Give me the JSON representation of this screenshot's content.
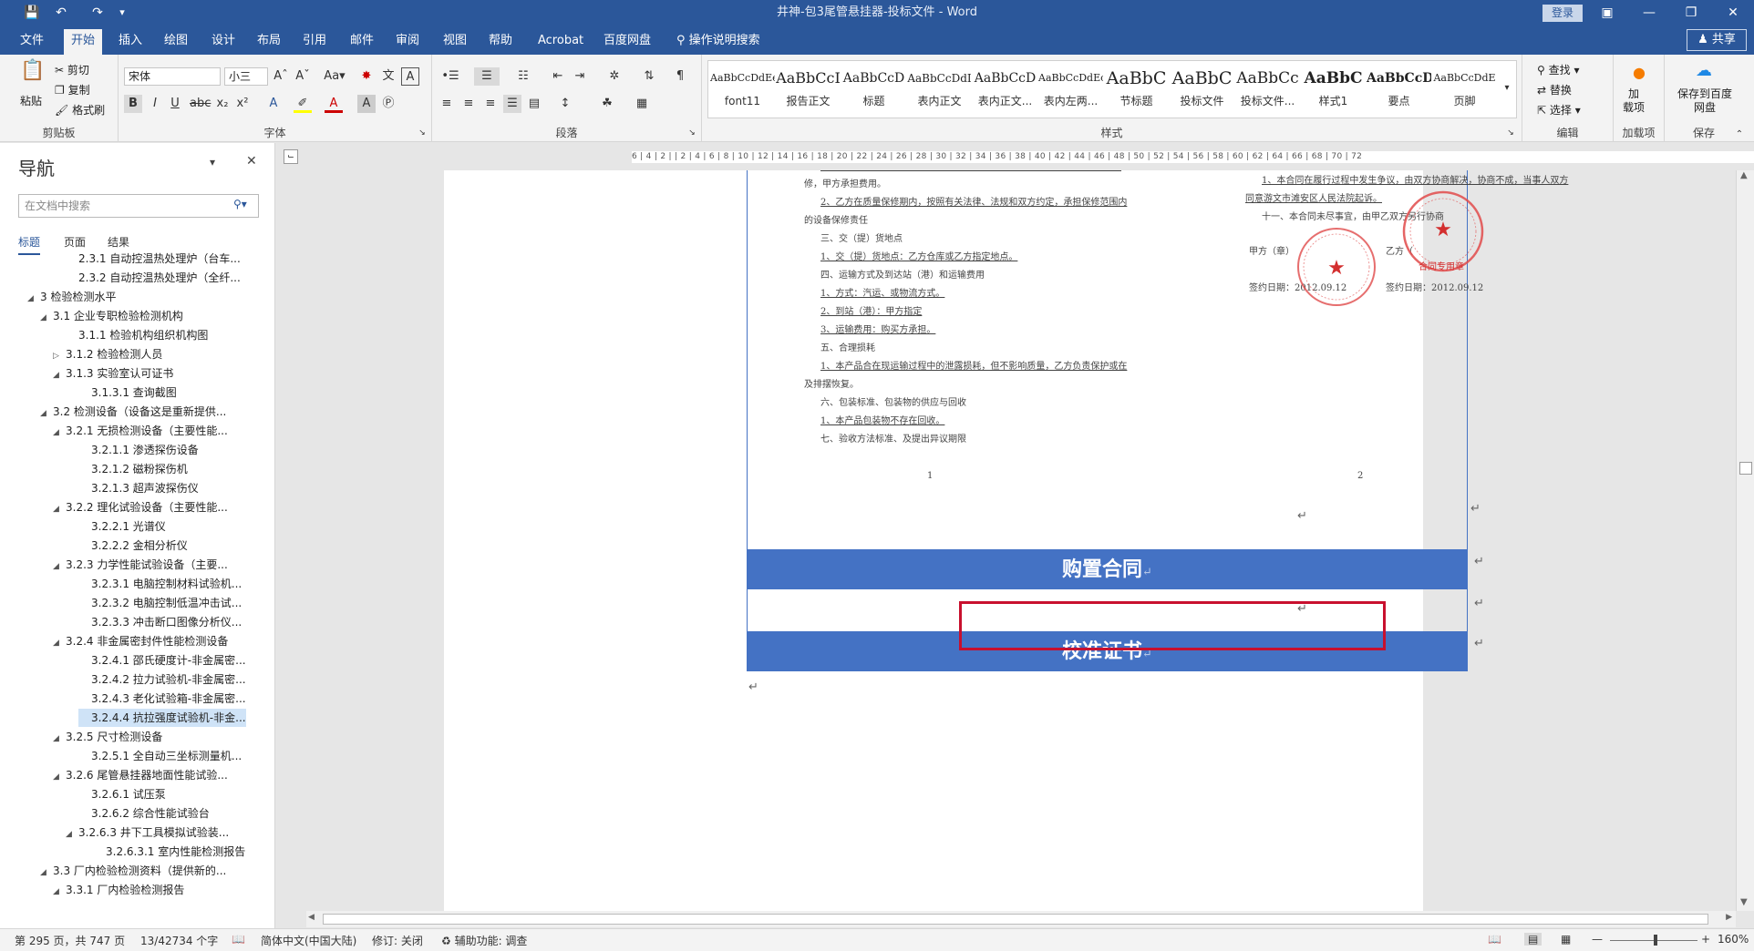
{
  "window": {
    "title": "井神-包3尾管悬挂器-投标文件 - Word",
    "login": "登录",
    "share": "共享"
  },
  "tabs": [
    "文件",
    "开始",
    "插入",
    "绘图",
    "设计",
    "布局",
    "引用",
    "邮件",
    "审阅",
    "视图",
    "帮助",
    "Acrobat",
    "百度网盘",
    "操作说明搜索"
  ],
  "ribbon": {
    "clipboard": {
      "paste": "粘贴",
      "cut": "剪切",
      "copy": "复制",
      "format_painter": "格式刷",
      "label": "剪贴板"
    },
    "font": {
      "name": "宋体",
      "size": "小三",
      "label": "字体"
    },
    "paragraph": {
      "label": "段落"
    },
    "styles": {
      "label": "样式",
      "items": [
        {
          "preview": "AaBbCcDdEe",
          "name": "font11"
        },
        {
          "preview": "AaBbCcI",
          "name": "报告正文"
        },
        {
          "preview": "AaBbCcD",
          "name": "标题"
        },
        {
          "preview": "AaBbCcDdI",
          "name": "表内正文"
        },
        {
          "preview": "AaBbCcD",
          "name": "表内正文..."
        },
        {
          "preview": "AaBbCcDdEc",
          "name": "表内左两..."
        },
        {
          "preview": "AaBbC",
          "name": "节标题"
        },
        {
          "preview": "AaBbC",
          "name": "投标文件"
        },
        {
          "preview": "AaBbCc",
          "name": "投标文件..."
        },
        {
          "preview": "AaBbC",
          "name": "样式1"
        },
        {
          "preview": "AaBbCcD",
          "name": "要点"
        },
        {
          "preview": "AaBbCcDdE",
          "name": "页脚"
        }
      ]
    },
    "editing": {
      "find": "查找",
      "replace": "替换",
      "select": "选择",
      "label": "编辑"
    },
    "addins": {
      "button": "加\n载项",
      "label": "加载项"
    },
    "save": {
      "button": "保存到百度网盘",
      "label": "保存"
    }
  },
  "nav": {
    "title": "导航",
    "search_placeholder": "在文档中搜索",
    "tabs": [
      "标题",
      "页面",
      "结果"
    ],
    "items": [
      {
        "text": "2.3.1 自动控温热处理炉（台车...",
        "level": 4,
        "tri": ""
      },
      {
        "text": "2.3.2 自动控温热处理炉（全纤...",
        "level": 4,
        "tri": ""
      },
      {
        "text": "3 检验检测水平",
        "level": 1,
        "tri": "◢"
      },
      {
        "text": "3.1 企业专职检验检测机构",
        "level": 2,
        "tri": "◢"
      },
      {
        "text": "3.1.1 检验机构组织机构图",
        "level": 4,
        "tri": ""
      },
      {
        "text": "3.1.2 检验检测人员",
        "level": 3,
        "tri": "▷"
      },
      {
        "text": "3.1.3 实验室认可证书",
        "level": 3,
        "tri": "◢"
      },
      {
        "text": "3.1.3.1 查询截图",
        "level": 5,
        "tri": ""
      },
      {
        "text": "3.2 检测设备（设备这是重新提供...",
        "level": 2,
        "tri": "◢"
      },
      {
        "text": "3.2.1 无损检测设备（主要性能...",
        "level": 3,
        "tri": "◢"
      },
      {
        "text": "3.2.1.1 渗透探伤设备",
        "level": 5,
        "tri": ""
      },
      {
        "text": "3.2.1.2 磁粉探伤机",
        "level": 5,
        "tri": ""
      },
      {
        "text": "3.2.1.3 超声波探伤仪",
        "level": 5,
        "tri": ""
      },
      {
        "text": "3.2.2 理化试验设备（主要性能...",
        "level": 3,
        "tri": "◢"
      },
      {
        "text": "3.2.2.1 光谱仪",
        "level": 5,
        "tri": ""
      },
      {
        "text": "3.2.2.2 金相分析仪",
        "level": 5,
        "tri": ""
      },
      {
        "text": "3.2.3 力学性能试验设备（主要...",
        "level": 3,
        "tri": "◢"
      },
      {
        "text": "3.2.3.1 电脑控制材料试验机...",
        "level": 5,
        "tri": ""
      },
      {
        "text": "3.2.3.2 电脑控制低温冲击试...",
        "level": 5,
        "tri": ""
      },
      {
        "text": "3.2.3.3 冲击断口图像分析仪...",
        "level": 5,
        "tri": ""
      },
      {
        "text": "3.2.4 非金属密封件性能检测设备",
        "level": 3,
        "tri": "◢"
      },
      {
        "text": "3.2.4.1 邵氏硬度计-非金属密...",
        "level": 5,
        "tri": ""
      },
      {
        "text": "3.2.4.2 拉力试验机-非金属密...",
        "level": 5,
        "tri": ""
      },
      {
        "text": "3.2.4.3 老化试验箱-非金属密...",
        "level": 5,
        "tri": ""
      },
      {
        "text": "3.2.4.4 抗拉强度试验机-非金...",
        "level": 5,
        "tri": "",
        "selected": true
      },
      {
        "text": "3.2.5 尺寸检测设备",
        "level": 3,
        "tri": "◢"
      },
      {
        "text": "3.2.5.1 全自动三坐标测量机...",
        "level": 5,
        "tri": ""
      },
      {
        "text": "3.2.6 尾管悬挂器地面性能试验...",
        "level": 3,
        "tri": "◢"
      },
      {
        "text": "3.2.6.1 试压泵",
        "level": 5,
        "tri": ""
      },
      {
        "text": "3.2.6.2 综合性能试验台",
        "level": 5,
        "tri": ""
      },
      {
        "text": "3.2.6.3 井下工具模拟试验装...",
        "level": 4,
        "tri": "◢"
      },
      {
        "text": "3.2.6.3.1 室内性能检测报告",
        "level": 6,
        "tri": ""
      },
      {
        "text": "3.3 厂内检验检测资料（提供新的...",
        "level": 2,
        "tri": "◢"
      },
      {
        "text": "3.3.1 厂内检验检测报告",
        "level": 3,
        "tri": "◢"
      }
    ]
  },
  "ruler": "6 | 4 | 2 | | 2 | 4 | 6 | 8 | 10 | 12 | 14 | 16 | 18 | 20 | 22 | 24 | 26 | 28 | 30 | 32 | 34 | 36 | 38 | 40 | 42 | 44 | 46 | 48 | 50 | 52 | 54 | 56 | 58 | 60 | 62 | 64 | 66 | 68 | 70 | 72",
  "doc": {
    "left_lines": [
      {
        "text": "修，甲方承担费用。",
        "u": false
      },
      {
        "text": "2、乙方在质量保修期内，按照有关法律、法规和双方约定，承担保修范围内",
        "u": true
      },
      {
        "text": "的设备保修责任",
        "u": false
      },
      {
        "text": "三、交（提）货地点",
        "u": false
      },
      {
        "text": "1、交（提）货地点：乙方仓库或乙方指定地点。",
        "u": true
      },
      {
        "text": "四、运输方式及到达站（港）和运输费用",
        "u": false
      },
      {
        "text": "1、方式：汽运、或物流方式。",
        "u": true
      },
      {
        "text": "2、到站（港）：甲方指定",
        "u": true
      },
      {
        "text": "3、运输费用：购买方承担。",
        "u": true
      },
      {
        "text": "五、合理损耗",
        "u": false
      },
      {
        "text": "1、本产品合在现运输过程中的泄露损耗，但不影响质量，乙方负责保护或在",
        "u": true
      },
      {
        "text": "及排摆恢复。",
        "u": false
      },
      {
        "text": "六、包装标准、包装物的供应与回收",
        "u": false
      },
      {
        "text": "1、本产品包装物不存在回收。",
        "u": true
      },
      {
        "text": "七、验收方法标准、及提出异议期限",
        "u": false
      }
    ],
    "right_lines": [
      {
        "text": "1、本合同在履行过程中发生争议，由双方协商解决，协商不成，当事人双方",
        "u": true
      },
      {
        "text": "同意游文市滩安区人民法院起诉。",
        "u": true
      },
      {
        "text": "十一、本合同未尽事宜，由甲乙双方另行协商",
        "u": false
      }
    ],
    "party_a": "甲方（章）",
    "party_b": "乙方（",
    "date_a": "签约日期：2012.09.12",
    "date_b": "签约日期：2012.09.12",
    "stamp_b_text": "合同专用章",
    "page_num_left": "1",
    "page_num_right": "2",
    "band1": "购置合同",
    "band2": "校准证书",
    "highlight_color": "#c8102e",
    "band_color": "#4472c4"
  },
  "status": {
    "page": "第 295 页，共 747 页",
    "words": "13/42734 个字",
    "lang": "简体中文(中国大陆)",
    "track": "修订: 关闭",
    "access": "辅助功能: 调查",
    "zoom": "160%"
  }
}
